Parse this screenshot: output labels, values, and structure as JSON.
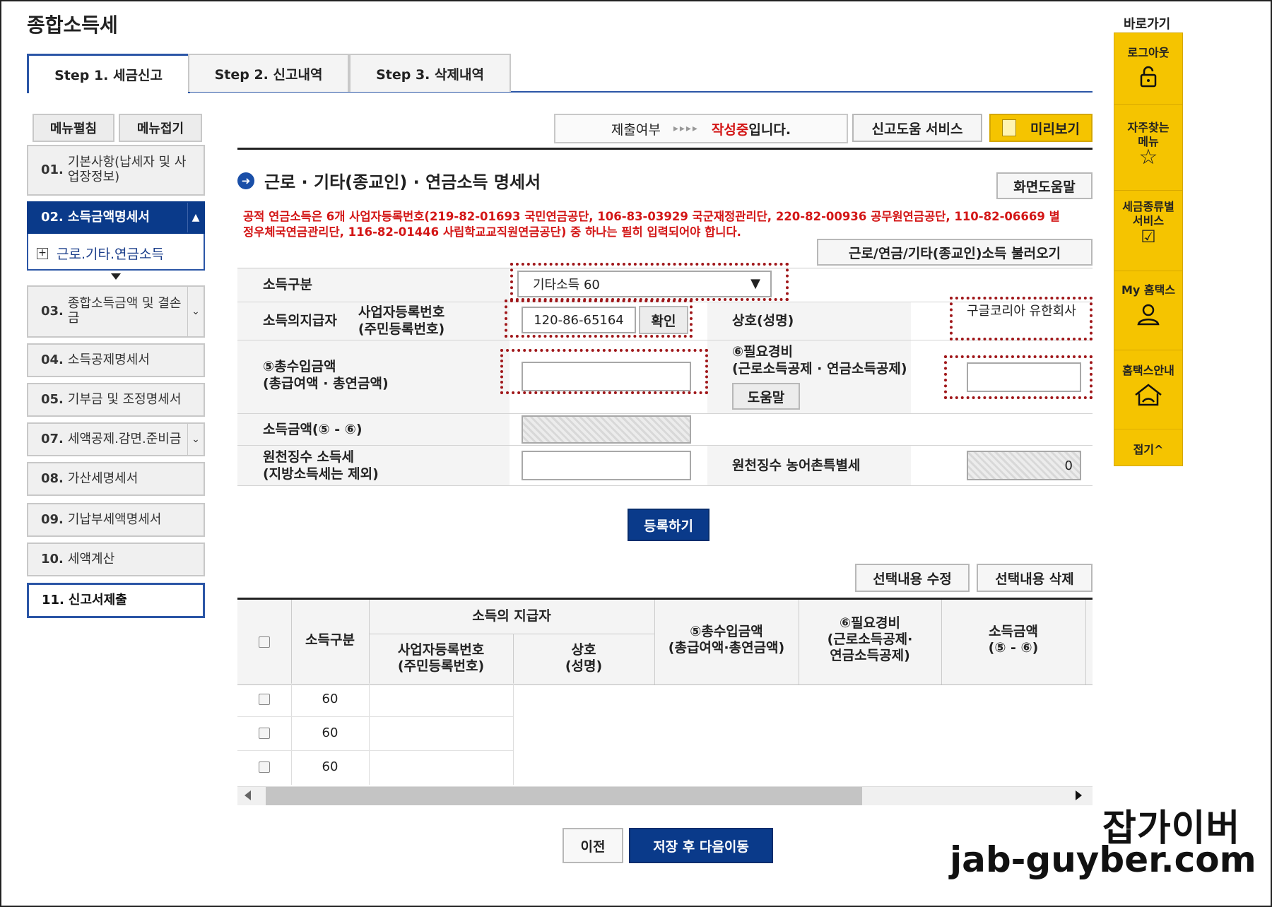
{
  "page_title": "종합소득세",
  "steps": [
    {
      "label": "Step 1. 세금신고"
    },
    {
      "label": "Step 2. 신고내역"
    },
    {
      "label": "Step 3. 삭제내역"
    }
  ],
  "menu_buttons": {
    "expand": "메뉴펼침",
    "collapse": "메뉴접기"
  },
  "menu": [
    {
      "num": "01.",
      "label": "기본사항(납세자 및 사업장정보)"
    },
    {
      "num": "02.",
      "label": "소득금액명세서"
    },
    {
      "sub": "근로.기타.연금소득"
    },
    {
      "num": "03.",
      "label": "종합소득금액 및 결손금"
    },
    {
      "num": "04.",
      "label": "소득공제명세서"
    },
    {
      "num": "05.",
      "label": "기부금 및 조정명세서"
    },
    {
      "num": "07.",
      "label": "세액공제.감면.준비금"
    },
    {
      "num": "08.",
      "label": "가산세명세서"
    },
    {
      "num": "09.",
      "label": "기납부세액명세서"
    },
    {
      "num": "10.",
      "label": "세액계산"
    },
    {
      "num": "11.",
      "label": "신고서제출"
    }
  ],
  "status": {
    "prefix": "제출여부",
    "arrows": "▸▸▸▸",
    "state": "작성중",
    "suffix": "입니다."
  },
  "buttons": {
    "help_service": "신고도움 서비스",
    "preview": "미리보기",
    "screen_help": "화면도움말",
    "load_income": "근로/연금/기타(종교인)소득 불러오기",
    "confirm": "확인",
    "help": "도움말",
    "register": "등록하기",
    "edit_selected": "선택내용 수정",
    "delete_selected": "선택내용 삭제",
    "prev": "이전",
    "save_next": "저장 후 다음이동"
  },
  "section_title": "근로 · 기타(종교인) · 연금소득 명세서",
  "notice": "공적 연금소득은 6개 사업자등록번호(219-82-01693 국민연금공단, 106-83-03929 국군재정관리단, 220-82-00936 공무원연금공단, 110-82-06669 별정우체국연금관리단, 116-82-01446 사립학교교직원연금공단) 중 하나는 필히 입력되어야 합니다.",
  "form": {
    "income_type_label": "소득구분",
    "income_type_value": "기타소득 60",
    "payer_label": "소득의지급자",
    "bizno_label1": "사업자등록번호",
    "bizno_label2": "(주민등록번호)",
    "bizno_value": "120-86-65164",
    "company_label": "상호(성명)",
    "company_value": "구글코리아 유한회사",
    "total_income_label1": "⑤총수입금액",
    "total_income_label2": "(총급여액 · 총연금액)",
    "total_income_value": "",
    "expense_label1": "⑥필요경비",
    "expense_label2": "(근로소득공제 · 연금소득공제)",
    "expense_value": "",
    "income_amount_label": "소득금액(⑤ - ⑥)",
    "withholding_label1": "원천징수 소득세",
    "withholding_label2": "(지방소득세는 제외)",
    "withholding_value": "",
    "rural_tax_label": "원천징수 농어촌특별세",
    "rural_tax_value": "0"
  },
  "table": {
    "col_income_type": "소득구분",
    "col_payer_group": "소득의 지급자",
    "col_bizno1": "사업자등록번호",
    "col_bizno2": "(주민등록번호)",
    "col_company1": "상호",
    "col_company2": "(성명)",
    "col_total1": "⑤총수입금액",
    "col_total2": "(총급여액·총연금액)",
    "col_expense1": "⑥필요경비",
    "col_expense2": "(근로소득공제·",
    "col_expense3": "연금소득공제)",
    "col_amount1": "소득금액",
    "col_amount2": "(⑤ - ⑥)",
    "rows": [
      {
        "type": "60"
      },
      {
        "type": "60"
      },
      {
        "type": "60"
      }
    ]
  },
  "sidebar": {
    "title": "바로가기",
    "items": [
      {
        "label": "로그아웃",
        "icon": "lock-icon"
      },
      {
        "label": "자주찾는메뉴",
        "icon": "star-icon"
      },
      {
        "label": "세금종류별서비스",
        "icon": "checkbox-icon"
      },
      {
        "label": "My 홈택스",
        "icon": "user-icon"
      },
      {
        "label": "홈택스안내",
        "icon": "home-icon"
      }
    ],
    "fold": "접기^"
  },
  "watermark": {
    "name": "잡가이버",
    "url": "jab-guyber.com"
  },
  "colors": {
    "navy": "#0a3a8a",
    "yellow": "#f5c400",
    "red": "#d31616",
    "dotted_border": "#a0171a"
  }
}
